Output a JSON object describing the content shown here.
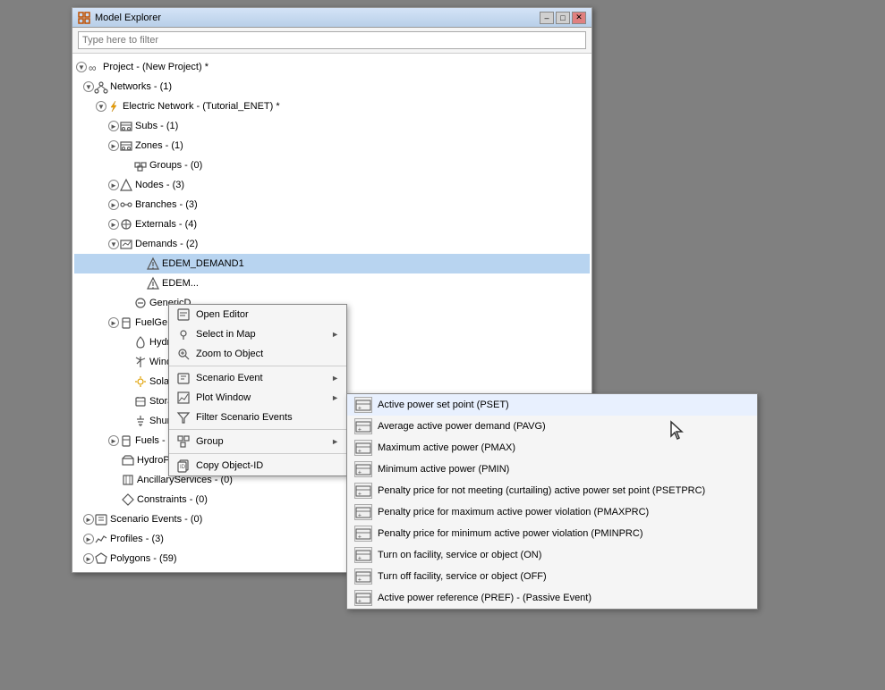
{
  "window": {
    "title": "Model Explorer",
    "filter_placeholder": "Type here to filter"
  },
  "tree": {
    "items": [
      {
        "id": "project",
        "label": "Project - (New Project) *",
        "indent": 0,
        "expanded": true,
        "icon": "infinity"
      },
      {
        "id": "networks",
        "label": "Networks - (1)",
        "indent": 1,
        "expanded": true,
        "icon": "network"
      },
      {
        "id": "electric-network",
        "label": "Electric Network - (Tutorial_ENET) *",
        "indent": 2,
        "expanded": true,
        "icon": "electric"
      },
      {
        "id": "subs",
        "label": "Subs - (1)",
        "indent": 3,
        "expanded": false,
        "icon": "subs"
      },
      {
        "id": "zones",
        "label": "Zones - (1)",
        "indent": 3,
        "expanded": false,
        "icon": "zones"
      },
      {
        "id": "groups",
        "label": "Groups - (0)",
        "indent": 4,
        "icon": "groups"
      },
      {
        "id": "nodes",
        "label": "Nodes - (3)",
        "indent": 3,
        "expanded": false,
        "icon": "nodes"
      },
      {
        "id": "branches",
        "label": "Branches - (3)",
        "indent": 3,
        "expanded": false,
        "icon": "branches"
      },
      {
        "id": "externals",
        "label": "Externals - (4)",
        "indent": 3,
        "expanded": false,
        "icon": "externals"
      },
      {
        "id": "demands",
        "label": "Demands - (2)",
        "indent": 3,
        "expanded": true,
        "icon": "demands"
      },
      {
        "id": "edem1",
        "label": "EDEM_DEMAND1",
        "indent": 5,
        "selected": true,
        "icon": "demand-item"
      },
      {
        "id": "edem2",
        "label": "EDEM...",
        "indent": 5,
        "icon": "demand-item"
      },
      {
        "id": "genericd",
        "label": "GenericD...",
        "indent": 4,
        "icon": "generic"
      },
      {
        "id": "fuelge",
        "label": "FuelGe...",
        "indent": 3,
        "expanded": false,
        "icon": "fuel"
      },
      {
        "id": "hydrog",
        "label": "HydroG...",
        "indent": 4,
        "icon": "hydro"
      },
      {
        "id": "windge",
        "label": "WindGe...",
        "indent": 4,
        "icon": "wind"
      },
      {
        "id": "solargi",
        "label": "SolarGe...",
        "indent": 4,
        "icon": "solar"
      },
      {
        "id": "storage",
        "label": "Storage...",
        "indent": 4,
        "icon": "storage"
      },
      {
        "id": "shunts",
        "label": "Shunts...",
        "indent": 4,
        "icon": "shunts"
      },
      {
        "id": "fuels",
        "label": "Fuels - (1)",
        "indent": 3,
        "expanded": false,
        "icon": "fuels"
      },
      {
        "id": "hydroplants",
        "label": "HydroPlants - (0)",
        "indent": 3,
        "icon": "hydroplants"
      },
      {
        "id": "ancillary",
        "label": "AncillaryServices - (0)",
        "indent": 3,
        "icon": "ancillary"
      },
      {
        "id": "constraints",
        "label": "Constraints - (0)",
        "indent": 3,
        "icon": "constraints"
      },
      {
        "id": "scenario-events",
        "label": "Scenario Events - (0)",
        "indent": 1,
        "expanded": false,
        "icon": "scenario"
      },
      {
        "id": "profiles",
        "label": "Profiles - (3)",
        "indent": 1,
        "expanded": false,
        "icon": "profiles"
      },
      {
        "id": "polygons",
        "label": "Polygons - (59)",
        "indent": 1,
        "expanded": false,
        "icon": "polygons"
      }
    ]
  },
  "context_menu": {
    "items": [
      {
        "id": "open-editor",
        "label": "Open Editor",
        "icon": "editor",
        "has_arrow": false
      },
      {
        "id": "select-in-map",
        "label": "Select in Map",
        "icon": "map-select",
        "has_arrow": true
      },
      {
        "id": "zoom-to-object",
        "label": "Zoom to Object",
        "icon": "zoom",
        "has_arrow": false
      },
      {
        "id": "scenario-event",
        "label": "Scenario Event",
        "icon": "scenario-ev",
        "has_arrow": true
      },
      {
        "id": "plot-window",
        "label": "Plot Window",
        "icon": "plot",
        "has_arrow": true
      },
      {
        "id": "filter-events",
        "label": "Filter Scenario Events",
        "icon": "filter",
        "has_arrow": false
      },
      {
        "id": "group",
        "label": "Group",
        "icon": "group",
        "has_arrow": true
      },
      {
        "id": "copy-id",
        "label": "Copy Object-ID",
        "icon": "copy",
        "has_arrow": false
      }
    ]
  },
  "scenario_submenu": {
    "items": [
      {
        "id": "pset",
        "label": "Active power set point (PSET)",
        "highlighted": true
      },
      {
        "id": "pavg",
        "label": "Average active power demand (PAVG)"
      },
      {
        "id": "pmax",
        "label": "Maximum active power (PMAX)"
      },
      {
        "id": "pmin",
        "label": "Minimum active power (PMIN)"
      },
      {
        "id": "psetprc",
        "label": "Penalty price for not meeting (curtailing) active power set point  (PSETPRC)"
      },
      {
        "id": "pmaxprc",
        "label": "Penalty price for maximum active power violation (PMAXPRC)"
      },
      {
        "id": "pminprc",
        "label": "Penalty price for minimum active power violation (PMINPRC)"
      },
      {
        "id": "turn-on",
        "label": "Turn on facility, service or object (ON)"
      },
      {
        "id": "turn-off",
        "label": "Turn off facility, service or object (OFF)"
      },
      {
        "id": "pref",
        "label": "Active power reference (PREF) - (Passive Event)"
      }
    ]
  }
}
